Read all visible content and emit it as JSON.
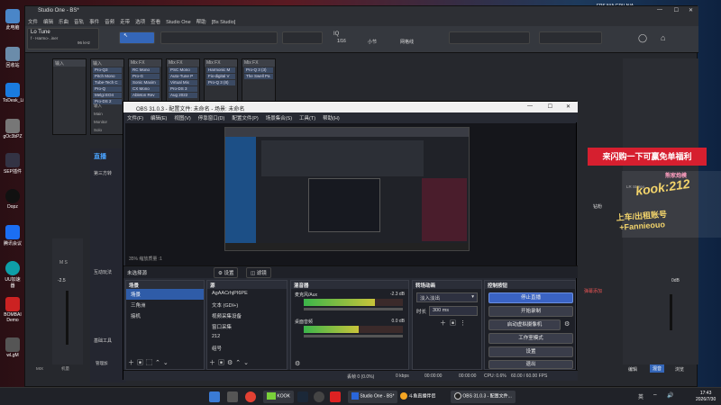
{
  "desktop": {
    "icons": [
      "此电脑",
      "回收站",
      "ToDesk_Li",
      "gOc3bPZ",
      "SEP插件",
      "Dopz",
      "腾讯会议",
      "UU加速器",
      "BOMBAI Demo",
      "wLgM"
    ],
    "tray_top": "FPS N/A  GPU N/A",
    "time": "17:43",
    "date": "2026/7/30",
    "ime": "英"
  },
  "studio_one": {
    "title": "Studio One - BS*",
    "menu": [
      "文件",
      "编辑",
      "乐曲",
      "音轨",
      "事件",
      "音频",
      "走带",
      "选项",
      "查看",
      "Studio One",
      "帮助",
      "[Bs Studio]"
    ],
    "device": "Lo Tune",
    "preset": "f - Harmo-..iner",
    "rate": "96 kHz",
    "quant": "1/16",
    "timebase": "小节",
    "snap": "网格线",
    "mixer_labels": [
      "输入",
      "Mix FX",
      "Mix FX",
      "Mix FX",
      "Mix FX"
    ],
    "plugins": [
      [
        "Pro-Q3",
        "Pitch Mono",
        "Tube-Tech C",
        "Pro-Q",
        "Melgi EO4",
        "Pro-DS 2"
      ],
      [
        "RC Mono",
        "Pro-G",
        "Sonic Maxim",
        "CX Mono",
        "Ableton Rev"
      ],
      [
        "PSC Mono",
        "Auto-Tune P",
        "Virtual Mix",
        "Pro-DS 3",
        "Aug 2022"
      ],
      [
        "Harmonic M",
        "Fix-digital V",
        "Pro-Q 3 (8)"
      ],
      [
        "Pro-Q 3 (3)",
        "The Swell Pa"
      ]
    ],
    "channel_labels": [
      "输入",
      "Main",
      "Monitor",
      "Solo"
    ],
    "level": "-2.5",
    "bottom_labels": [
      "MIX",
      "机量"
    ],
    "right_labels": [
      "编辑",
      "混音",
      "浏览"
    ],
    "value_right": "0dB",
    "lr": "LR Stereo"
  },
  "obs": {
    "title": "OBS 31.0.3 - 配置文件: 未命名 - 场景: 未命名",
    "menu": [
      "文件(F)",
      "编辑(E)",
      "视图(V)",
      "停靠窗口(D)",
      "配置文件(P)",
      "场景集合(S)",
      "工具(T)",
      "帮助(H)"
    ],
    "zoom": "35% 缩放质量 :1",
    "no_source": "未选择源",
    "props": "设置",
    "filters": "滤镜",
    "scenes": {
      "title": "场景",
      "items": [
        "场景",
        "三角洲",
        "接机"
      ],
      "selected": 0
    },
    "sources": {
      "title": "源",
      "items": [
        "AgAACrhjPI6PE",
        "文本 (GDI+)",
        "视频采集设备",
        "窗口采集",
        "212",
        "组号"
      ]
    },
    "mixer": {
      "title": "混音器",
      "ch1": "麦克风/Aux",
      "ch1_db": "-2.3 dB",
      "ch2": "桌面音频",
      "ch2_db": "0.0 dB",
      "level1": 0.72,
      "level2": 0.55
    },
    "transitions": {
      "title": "转场动画",
      "type": "淡入淡出",
      "duration_label": "时长",
      "duration": "300 ms"
    },
    "controls": {
      "title": "控制按钮",
      "stop": "停止直播",
      "record": "开始录制",
      "vcam": "启动虚拟摄像机",
      "studio": "工作室模式",
      "settings": "设置",
      "exit": "退出"
    },
    "status": {
      "frames": "丢帧 0 (0.0%)",
      "kbps": "0 kbps",
      "t1": "00:00:00",
      "t2": "00:00:00",
      "t3": "00:00:00",
      "cpu": "CPU: 0.6%",
      "fps": "60.00 / 60.00 FPS"
    }
  },
  "stream_bar": {
    "brand": "直播",
    "third": "第三方转",
    "interact": "互动玩法",
    "tools": "基础工具",
    "manage": "管理加",
    "danmu": "弹幕"
  },
  "promo": {
    "banner": "来闪购一下可赢免单福利",
    "kook": "kook:212",
    "line1": "上车/出租账号",
    "line2": "+Fannieouo",
    "tag": "熊家炮模",
    "label": "钻粉",
    "badge": "弹幕添加"
  },
  "taskbar": {
    "apps": [
      "KOOK",
      "Studio One - BS*",
      "斗鱼直播伴侣",
      "OBS 31.0.3 - 配置文件..."
    ]
  }
}
